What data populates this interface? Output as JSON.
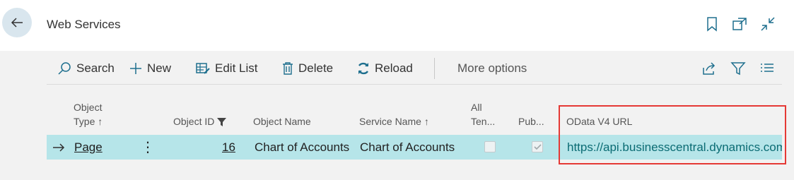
{
  "header": {
    "title": "Web Services",
    "back_icon": "arrow-left-icon",
    "bookmark_icon": "bookmark-icon",
    "open_new_icon": "open-in-new-window-icon",
    "collapse_icon": "collapse-icon"
  },
  "toolbar": {
    "search_label": "Search",
    "new_label": "New",
    "edit_list_label": "Edit List",
    "delete_label": "Delete",
    "reload_label": "Reload",
    "more_options_label": "More options",
    "share_icon": "share-icon",
    "filter_icon": "filter-icon",
    "list_icon": "list-view-icon"
  },
  "columns": {
    "object_type_line1": "Object",
    "object_type_line2": "Type",
    "object_id": "Object ID",
    "object_name": "Object Name",
    "service_name": "Service Name",
    "all_tenants_line1": "All",
    "all_tenants_line2": "Ten...",
    "published": "Pub...",
    "odata_v4_url": "OData V4 URL"
  },
  "row": {
    "object_type": "Page",
    "object_id": "16",
    "object_name": "Chart of Accounts",
    "service_name": "Chart of Accounts",
    "all_tenants": false,
    "published": true,
    "odata_v4_url": "https://api.businesscentral.dynamics.com"
  },
  "colors": {
    "selected_row": "#b6e5e9",
    "highlight_border": "#e53935",
    "accent": "#0b6c74"
  }
}
